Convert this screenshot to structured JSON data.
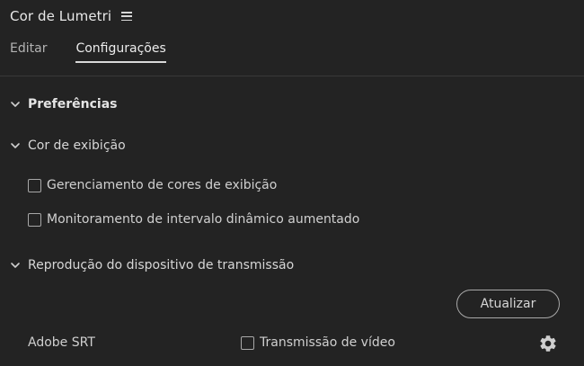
{
  "panel": {
    "title": "Cor de Lumetri",
    "menu_icon": "hamburger-menu-icon"
  },
  "tabs": [
    {
      "label": "Editar",
      "active": false
    },
    {
      "label": "Configurações",
      "active": true
    }
  ],
  "sections": {
    "preferences": {
      "label": "Preferências",
      "expanded": true
    },
    "display_color": {
      "label": "Cor de exibição",
      "expanded": true,
      "options": [
        {
          "label": "Gerenciamento de cores de exibição",
          "checked": false
        },
        {
          "label": "Monitoramento de intervalo dinâmico aumentado",
          "checked": false
        }
      ]
    },
    "transmit": {
      "label": "Reprodução do dispositivo de transmissão",
      "expanded": true,
      "update_label": "Atualizar",
      "devices": [
        {
          "name": "Adobe SRT",
          "option_label": "Transmissão de vídeo",
          "checked": false,
          "settings_icon": "gear-icon"
        }
      ]
    }
  },
  "colors": {
    "background": "#232323",
    "text": "#d6d6d6",
    "control_border": "#a8a8a8"
  }
}
